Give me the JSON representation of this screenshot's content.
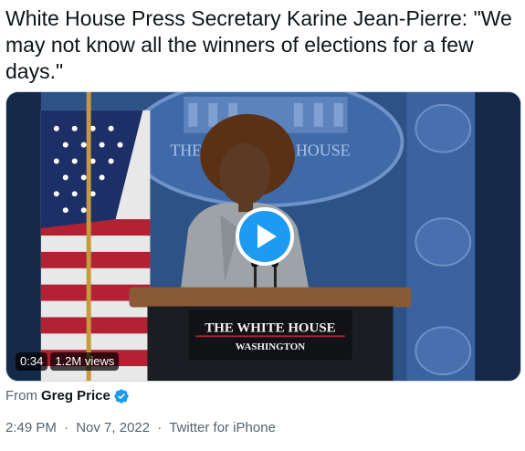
{
  "tweet": {
    "text": "White House Press Secretary Karine Jean-Pierre: \"We may not know all the winners of elections for a few days.\""
  },
  "video": {
    "duration": "0:34",
    "views": "1.2M views",
    "seal_text": "THE WHITE HOUSE",
    "podium_title": "THE WHITE HOUSE",
    "podium_subtitle": "WASHINGTON",
    "play_icon": "play-icon"
  },
  "attribution": {
    "prefix": "From",
    "author": "Greg Price",
    "verified_icon": "verified-badge-icon",
    "verified_color": "#1d9bf0"
  },
  "meta": {
    "time": "2:49 PM",
    "separator": "·",
    "date": "Nov 7, 2022",
    "source": "Twitter for iPhone"
  },
  "colors": {
    "accent": "#1d9bf0",
    "text": "#0f1419",
    "secondary": "#536471"
  }
}
